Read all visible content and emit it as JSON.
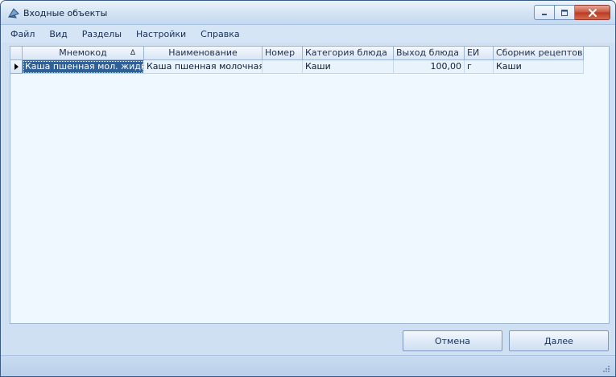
{
  "window": {
    "title": "Входные объекты",
    "icon": "app-icon"
  },
  "menu": [
    {
      "label": "Файл"
    },
    {
      "label": "Вид"
    },
    {
      "label": "Разделы"
    },
    {
      "label": "Настройки"
    },
    {
      "label": "Справка"
    }
  ],
  "grid": {
    "columns": [
      {
        "label": "Мнемокод",
        "sort": "ascending",
        "sort_glyph": "Δ"
      },
      {
        "label": "Наименование"
      },
      {
        "label": "Номер"
      },
      {
        "label": "Категория блюда"
      },
      {
        "label": "Выход блюда"
      },
      {
        "label": "ЕИ"
      },
      {
        "label": "Сборник рецептов"
      }
    ],
    "rows": [
      {
        "selected": true,
        "cells": [
          "Каша пшенная мол. жидк.",
          "Каша пшенная молочная ...",
          "",
          "Каши",
          "100,00",
          "г",
          "Каши"
        ]
      }
    ]
  },
  "buttons": {
    "cancel": "Отмена",
    "next": "Далее"
  },
  "colors": {
    "selection": "#2e5f96",
    "grid_background": "#eff8fe",
    "window_frame": "#cfe0f3"
  }
}
